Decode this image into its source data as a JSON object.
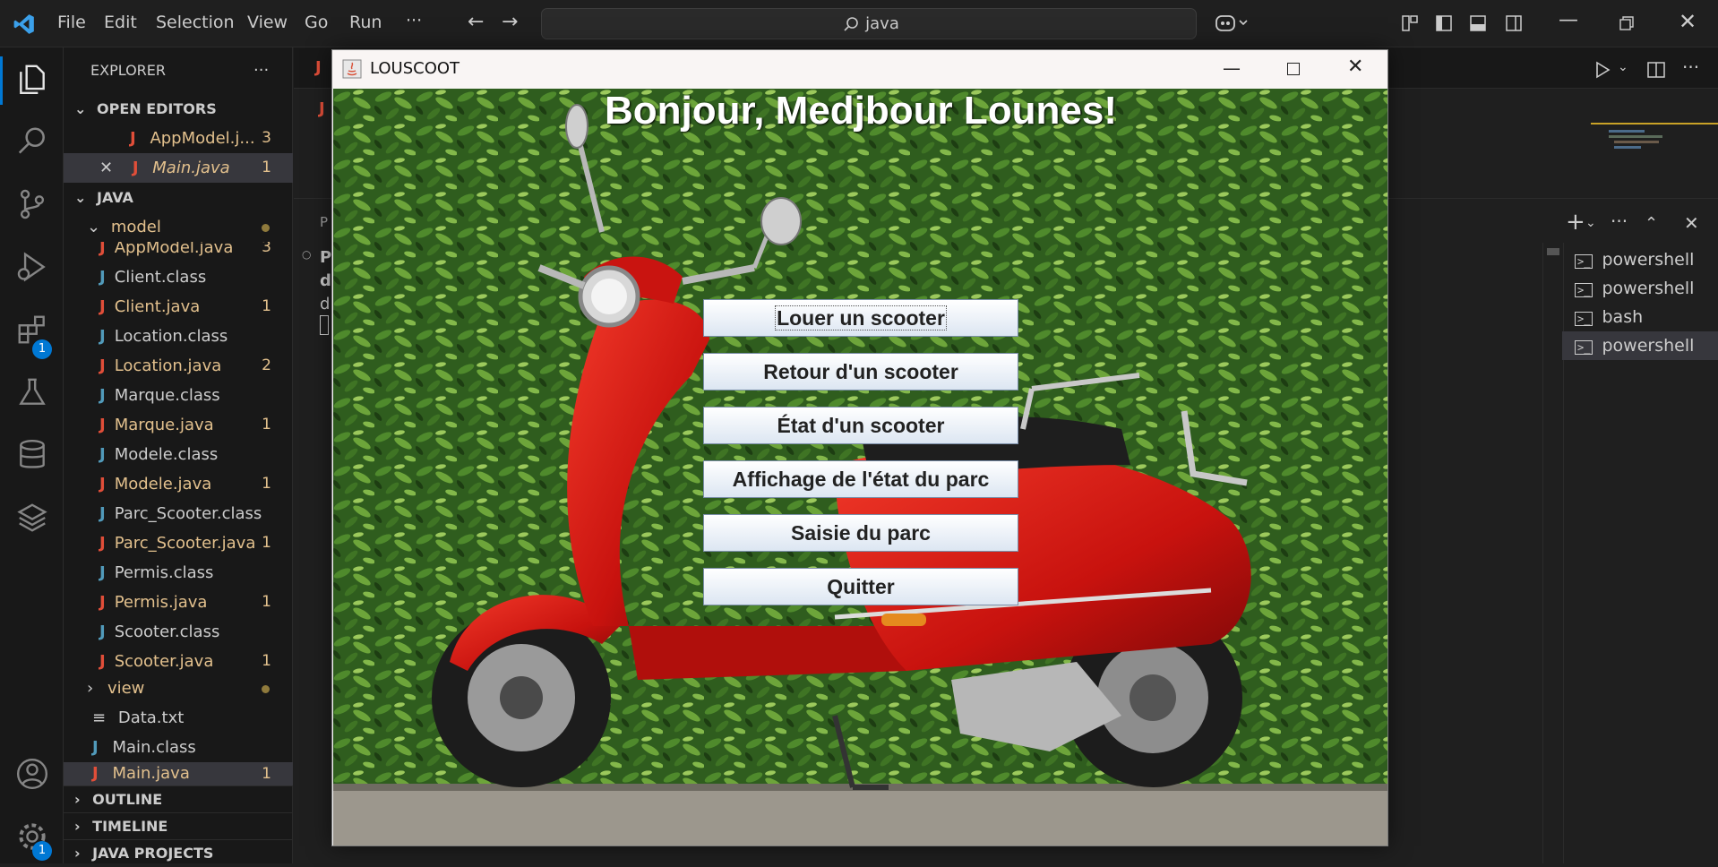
{
  "menu": [
    "File",
    "Edit",
    "Selection",
    "View",
    "Go",
    "Run",
    "···"
  ],
  "search": {
    "text": "java"
  },
  "activity": {
    "extensions_badge": "1",
    "settings_badge": "1"
  },
  "sidebar": {
    "title": "EXPLORER",
    "open_editors_label": "OPEN EDITORS",
    "open_editors": [
      {
        "name": "AppModel.j...",
        "count": "3"
      },
      {
        "name": "Main.java",
        "count": "1"
      }
    ],
    "java_label": "JAVA",
    "model_folder": "model",
    "files": [
      {
        "name": "AppModel.java",
        "count": "3",
        "kind": "java"
      },
      {
        "name": "Client.class",
        "count": "",
        "kind": "class"
      },
      {
        "name": "Client.java",
        "count": "1",
        "kind": "java"
      },
      {
        "name": "Location.class",
        "count": "",
        "kind": "class"
      },
      {
        "name": "Location.java",
        "count": "2",
        "kind": "java"
      },
      {
        "name": "Marque.class",
        "count": "",
        "kind": "class"
      },
      {
        "name": "Marque.java",
        "count": "1",
        "kind": "java"
      },
      {
        "name": "Modele.class",
        "count": "",
        "kind": "class"
      },
      {
        "name": "Modele.java",
        "count": "1",
        "kind": "java"
      },
      {
        "name": "Parc_Scooter.class",
        "count": "",
        "kind": "class"
      },
      {
        "name": "Parc_Scooter.java",
        "count": "1",
        "kind": "java"
      },
      {
        "name": "Permis.class",
        "count": "",
        "kind": "class"
      },
      {
        "name": "Permis.java",
        "count": "1",
        "kind": "java"
      },
      {
        "name": "Scooter.class",
        "count": "",
        "kind": "class"
      },
      {
        "name": "Scooter.java",
        "count": "1",
        "kind": "java"
      }
    ],
    "view_folder": "view",
    "root_files": [
      {
        "name": "Data.txt",
        "count": ""
      },
      {
        "name": "Main.class",
        "count": ""
      },
      {
        "name": "Main.java",
        "count": "1"
      }
    ],
    "outline_label": "OUTLINE",
    "timeline_label": "TIMELINE",
    "java_projects_label": "JAVA PROJECTS"
  },
  "java_window": {
    "title": "LOUSCOOT",
    "greeting": "Bonjour, Medjbour Lounes!",
    "buttons": [
      "Louer un scooter",
      "Retour d'un scooter",
      "État d'un scooter",
      "Affichage de l'état du parc",
      "Saisie du parc",
      "Quitter"
    ]
  },
  "terminals": [
    "powershell",
    "powershell",
    "bash",
    "powershell"
  ],
  "partial_text": {
    "panel_tab": "P",
    "line1": "Pl",
    "line2": "d",
    "line3": "d"
  },
  "colors": {
    "accent": "#0078d4",
    "error": "#e2c08d",
    "java_icon": "#e04e39",
    "class_icon": "#519aba"
  }
}
